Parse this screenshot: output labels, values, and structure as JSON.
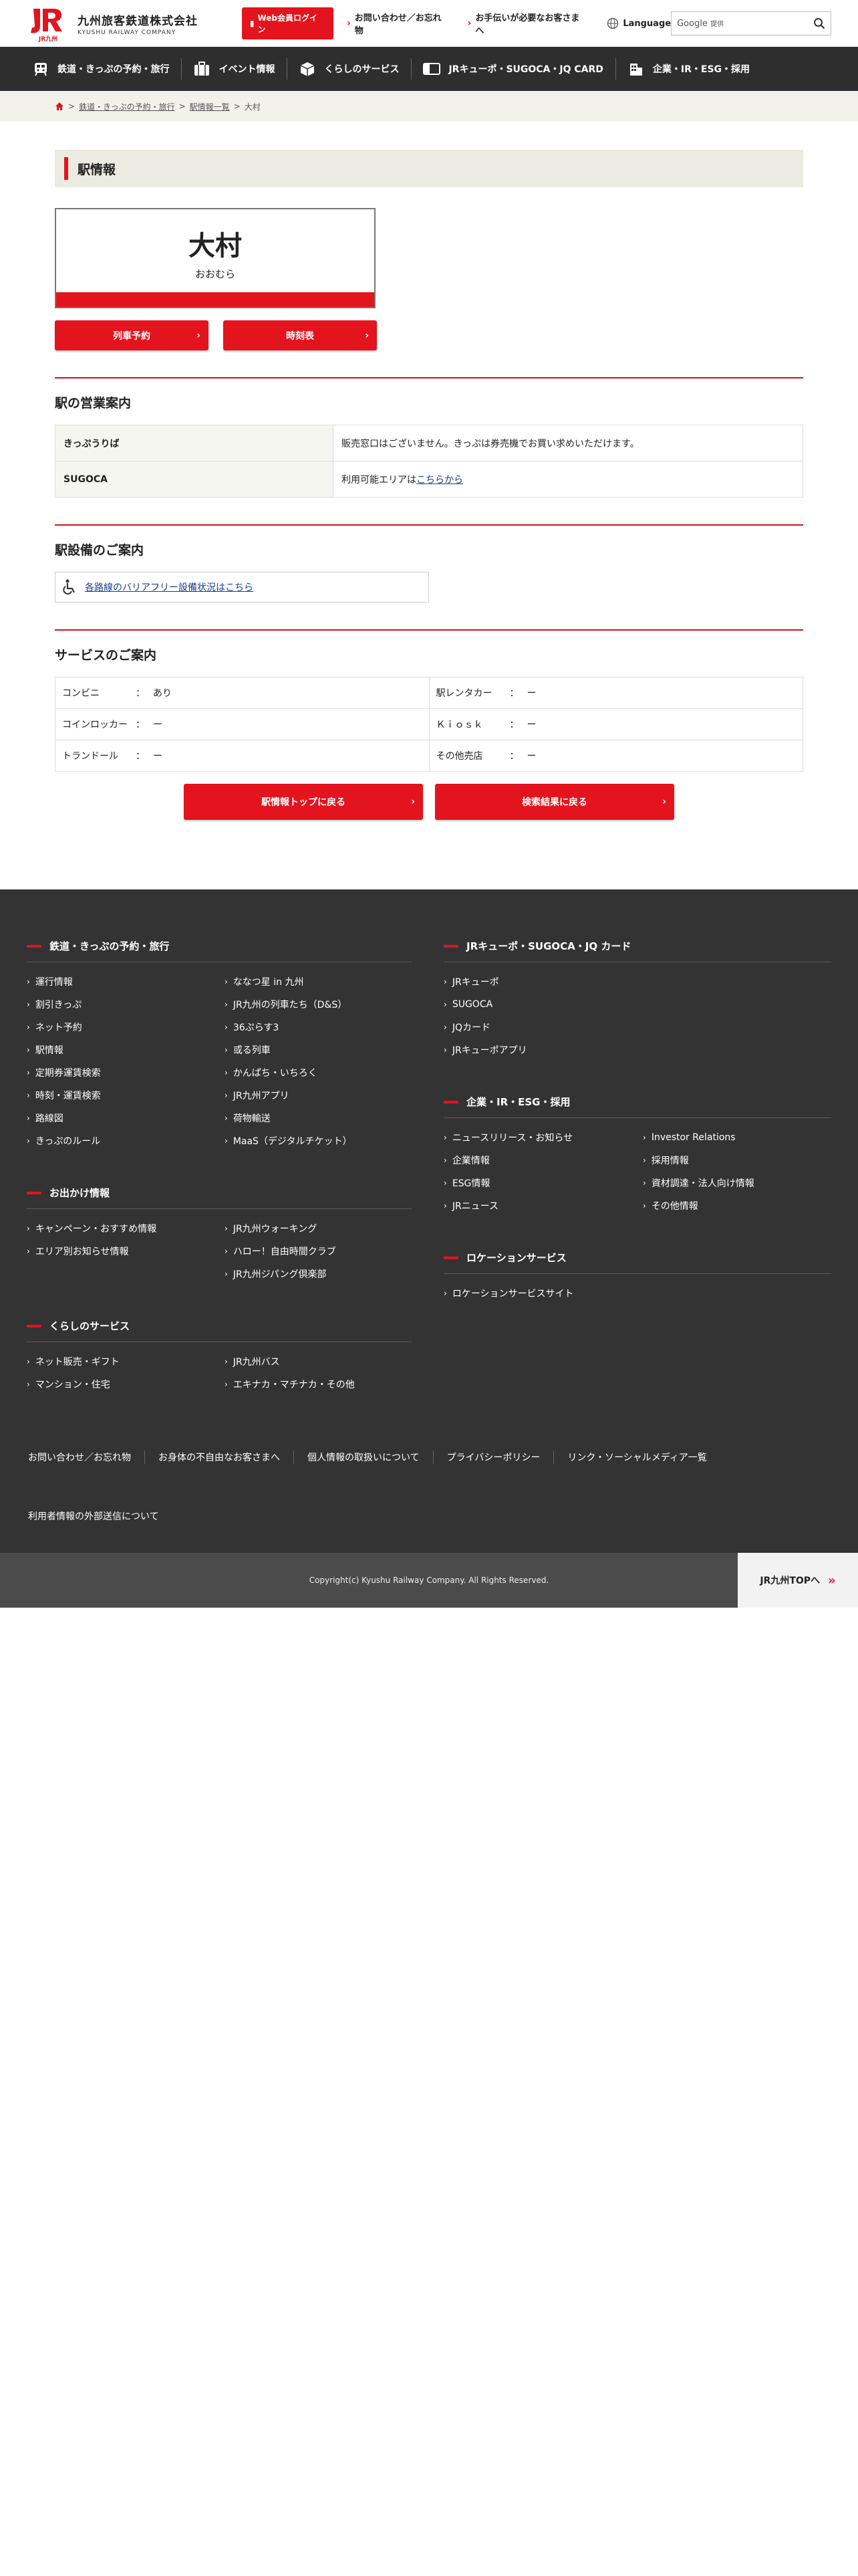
{
  "header": {
    "logo_ja": "九州旅客鉄道株式会社",
    "logo_en": "KYUSHU RAILWAY COMPANY",
    "logo_mark_sub": "JR九州",
    "web_login": "Web会員ログイン",
    "contact": "お問い合わせ／お忘れ物",
    "assist": "お手伝いが必要なお客さまへ",
    "language": "Language",
    "search_brand": "Google",
    "search_sub": "提供"
  },
  "gnav": [
    {
      "label": "鉄道・きっぷの予約・旅行",
      "icon": "train-icon"
    },
    {
      "label": "イベント情報",
      "icon": "suitcase-icon"
    },
    {
      "label": "くらしのサービス",
      "icon": "box-icon"
    },
    {
      "label": "JRキューポ・SUGOCA・JQ CARD",
      "icon": "card-icon"
    },
    {
      "label": "企業・IR・ESG・採用",
      "icon": "building-icon"
    }
  ],
  "breadcrumb": {
    "sep": ">",
    "item1": "鉄道・きっぷの予約・旅行",
    "item2": "駅情報一覧",
    "current": "大村"
  },
  "page": {
    "heading": "駅情報",
    "station_name": "大村",
    "station_kana": "おおむら",
    "btn_reserve": "列車予約",
    "btn_timetable": "時刻表"
  },
  "business": {
    "title": "駅の営業案内",
    "rows": [
      {
        "label": "きっぷうりば",
        "value": "販売窓口はございません。きっぷは券売機でお買い求めいただけます。",
        "link": ""
      },
      {
        "label": "SUGOCA",
        "value": "利用可能エリアは",
        "link": "こちらから"
      }
    ]
  },
  "facility": {
    "title": "駅設備のご案内",
    "barrier_link": "各路線のバリアフリー設備状況はこちら"
  },
  "services": {
    "title": "サービスのご案内",
    "colon": "：",
    "rows": [
      [
        {
          "label": "コンビニ",
          "value": "あり"
        },
        {
          "label": "駅レンタカー",
          "value": "ー"
        }
      ],
      [
        {
          "label": "コインロッカー",
          "value": "ー"
        },
        {
          "label": "Ｋｉｏｓｋ",
          "value": "ー"
        }
      ],
      [
        {
          "label": "トランドール",
          "value": "ー"
        },
        {
          "label": "その他売店",
          "value": "ー"
        }
      ]
    ]
  },
  "bottom_buttons": {
    "back_top": "駅情報トップに戻る",
    "back_search": "検索結果に戻る"
  },
  "footer": {
    "rail": {
      "title": "鉄道・きっぷの予約・旅行",
      "links": [
        "運行情報",
        "ななつ星 in 九州",
        "割引きっぷ",
        "JR九州の列車たち（D&S）",
        "ネット予約",
        "36ぷらす3",
        "駅情報",
        "或る列車",
        "定期券運賃検索",
        "かんぱち・いちろく",
        "時刻・運賃検索",
        "JR九州アプリ",
        "路線図",
        "荷物輸送",
        "きっぷのルール",
        "MaaS（デジタルチケット）"
      ]
    },
    "outing": {
      "title": "お出かけ情報",
      "links": [
        "キャンペーン・おすすめ情報",
        "JR九州ウォーキング",
        "エリア別お知らせ情報",
        "ハロー！自由時間クラブ",
        "",
        "JR九州ジパング倶楽部"
      ]
    },
    "life": {
      "title": "くらしのサービス",
      "links": [
        "ネット販売・ギフト",
        "JR九州バス",
        "マンション・住宅",
        "エキナカ・マチナカ・その他"
      ]
    },
    "card": {
      "title": "JRキューポ・SUGOCA・JQ カード",
      "links": [
        "JRキューポ",
        "SUGOCA",
        "JQカード",
        "JRキューポアプリ"
      ]
    },
    "corp": {
      "title": "企業・IR・ESG・採用",
      "links": [
        "ニュースリリース・お知らせ",
        "Investor Relations",
        "企業情報",
        "採用情報",
        "ESG情報",
        "資材調達・法人向け情報",
        "JRニュース",
        "その他情報"
      ]
    },
    "location": {
      "title": "ロケーションサービス",
      "links": [
        "ロケーションサービスサイト"
      ]
    },
    "bottom_links": [
      "お問い合わせ／お忘れ物",
      "お身体の不自由なお客さまへ",
      "個人情報の取扱いについて",
      "プライバシーポリシー",
      "リンク・ソーシャルメディア一覧",
      "利用者情報の外部送信について"
    ],
    "copyright": "Copyright(c) Kyushu Railway Company. All Rights Reserved.",
    "to_top": "JR九州TOPへ"
  }
}
